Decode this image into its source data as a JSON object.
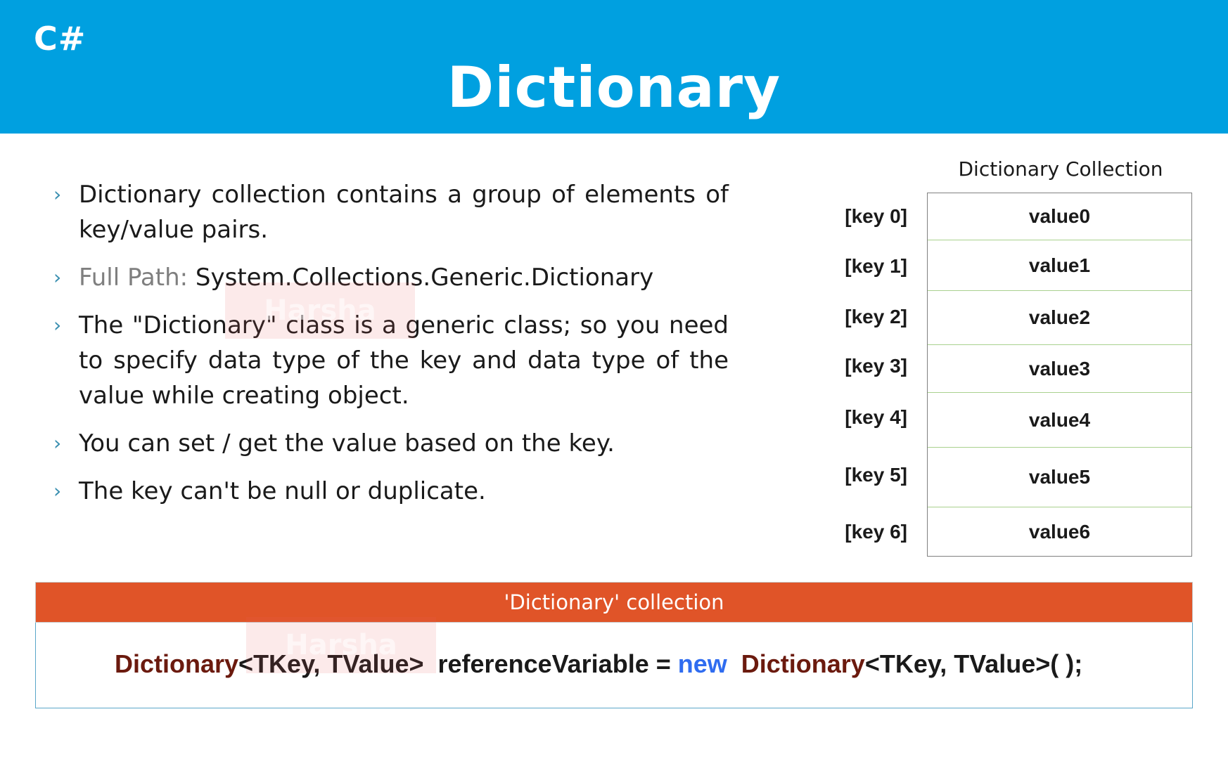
{
  "header": {
    "lang_tag": "C#",
    "title": "Dictionary"
  },
  "bullets": [
    {
      "text": "Dictionary collection contains a group of elements of key/value pairs."
    },
    {
      "label": "Full Path:",
      "text": "System.Collections.Generic.Dictionary"
    },
    {
      "text": "The \"Dictionary\" class is a generic class; so you need to specify data type of the key and data type of the value while creating object."
    },
    {
      "text": "You can set / get the value based on the key."
    },
    {
      "text": "The key can't be null or duplicate."
    }
  ],
  "bullet_marker": "›",
  "diagram": {
    "title": "Dictionary Collection",
    "rows": [
      {
        "key": "[key 0]",
        "value": "value0"
      },
      {
        "key": "[key 1]",
        "value": "value1"
      },
      {
        "key": "[key 2]",
        "value": "value2"
      },
      {
        "key": "[key 3]",
        "value": "value3"
      },
      {
        "key": "[key 4]",
        "value": "value4"
      },
      {
        "key": "[key 5]",
        "value": "value5"
      },
      {
        "key": "[key 6]",
        "value": "value6"
      }
    ]
  },
  "syntax": {
    "header": "'Dictionary' collection",
    "code": {
      "type1": "Dictionary",
      "generic1": "<TKey, TValue>",
      "var": "  referenceVariable = ",
      "keyword": "new",
      "type2": "Dictionary",
      "generic2": "<TKey, TValue>( );"
    }
  },
  "watermark": "Harsha",
  "colors": {
    "header_bg": "#00a0e0",
    "syntax_header_bg": "#e05428",
    "type_name": "#6b1a0e",
    "keyword": "#2f6cf0",
    "row_divider": "#a9d18e"
  }
}
